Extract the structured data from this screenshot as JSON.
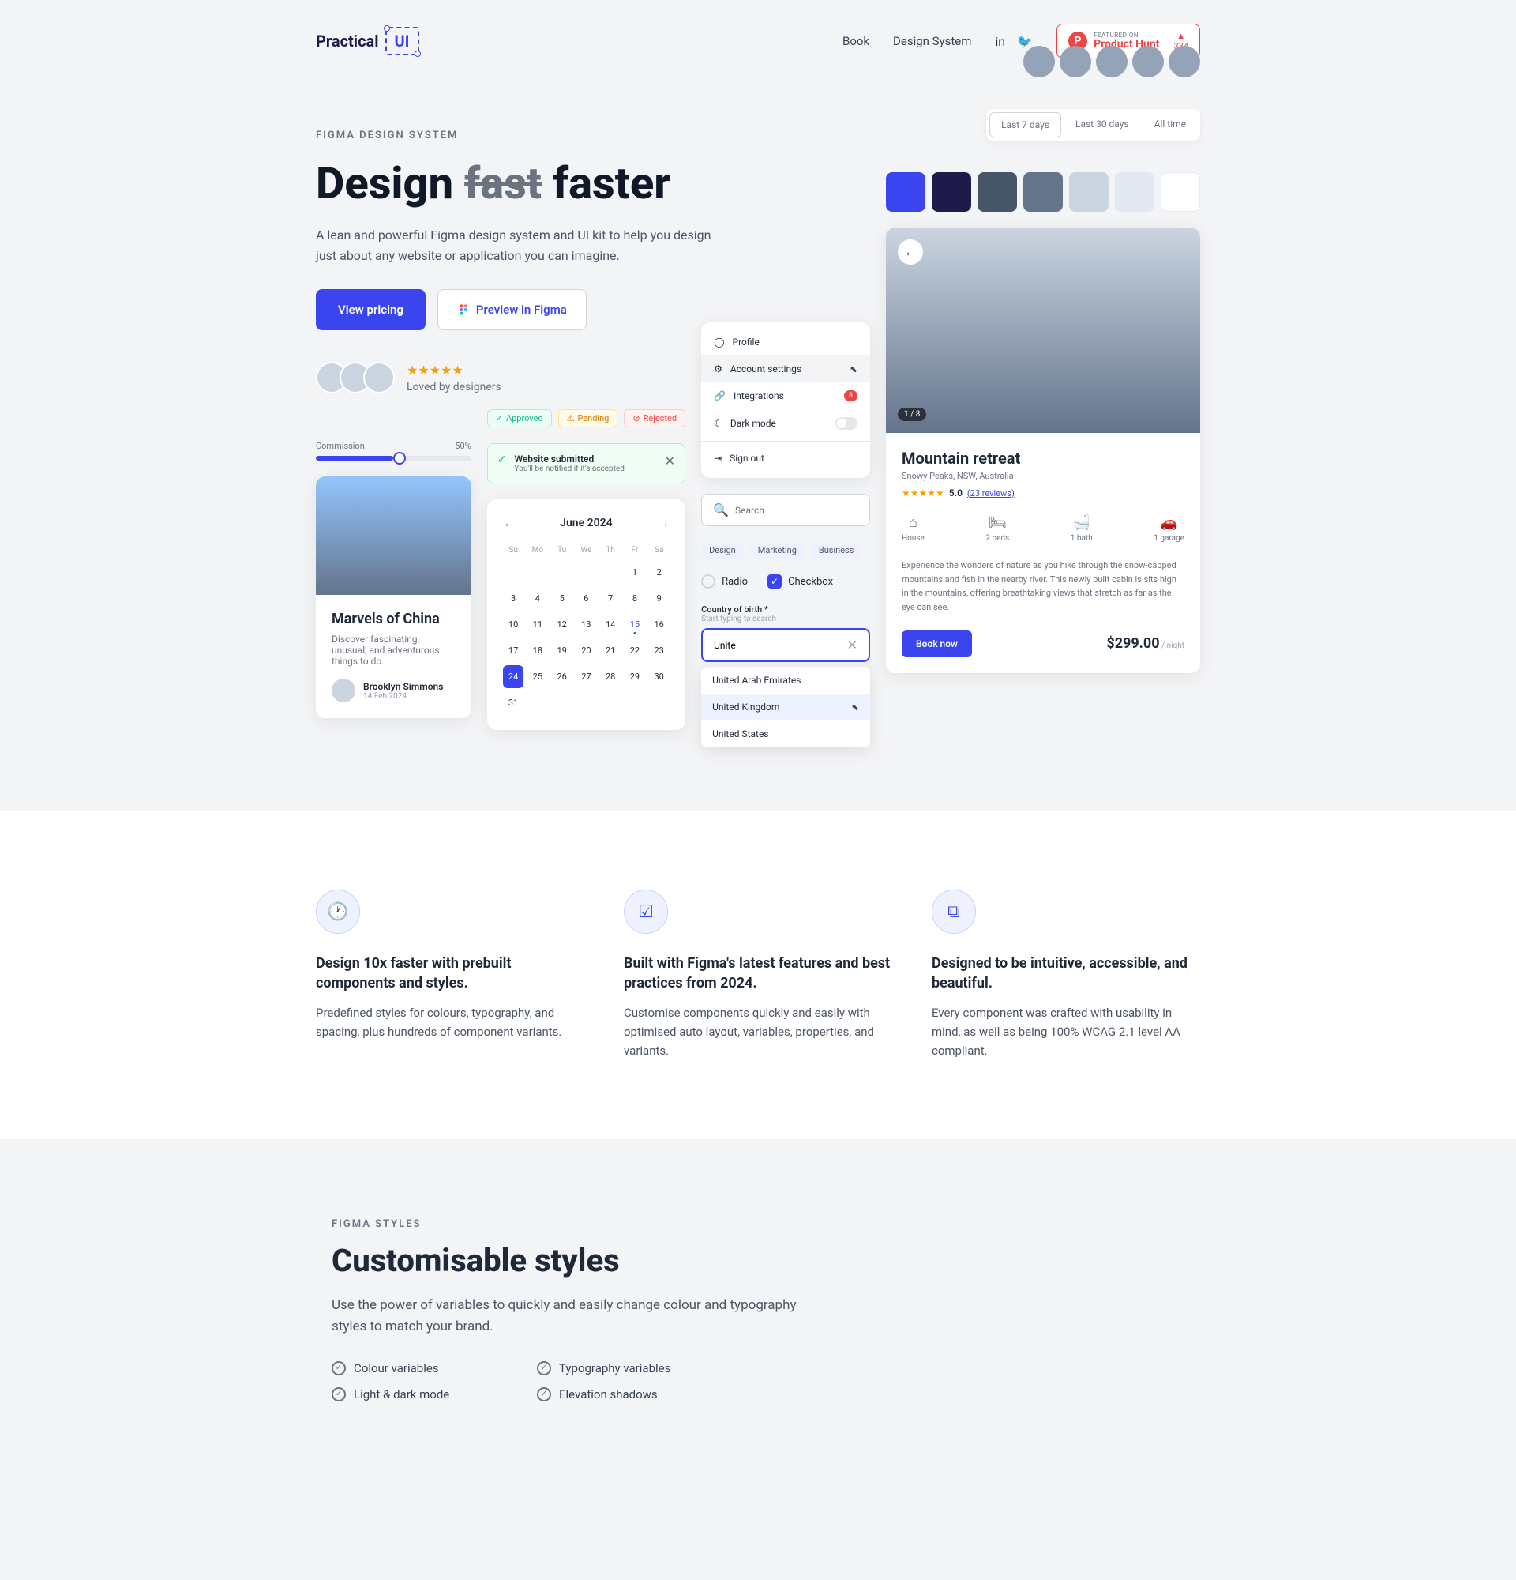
{
  "header": {
    "logo_text": "Practical",
    "logo_box": "UI",
    "nav": {
      "book": "Book",
      "design_system": "Design System"
    },
    "ph": {
      "featured": "FEATURED ON",
      "name": "Product Hunt",
      "count": "334"
    }
  },
  "hero": {
    "eyebrow": "FIGMA DESIGN SYSTEM",
    "title_a": "Design ",
    "title_strike": "fast",
    "title_b": " faster",
    "subtitle": "A lean and powerful Figma design system and UI kit to help you design just about any website or application you can imagine.",
    "btn_primary": "View pricing",
    "btn_secondary": "Preview in Figma",
    "loved": "Loved by designers"
  },
  "tabs": {
    "t1": "Last 7 days",
    "t2": "Last 30 days",
    "t3": "All time"
  },
  "swatches": [
    "#3b45ef",
    "#1e1b4b",
    "#475569",
    "#64748b",
    "#cbd5e1",
    "#e2e8f0",
    "#ffffff"
  ],
  "badges": {
    "approved": "Approved",
    "pending": "Pending",
    "rejected": "Rejected"
  },
  "slider": {
    "label": "Commission",
    "value": "50%"
  },
  "article": {
    "title": "Marvels of China",
    "desc": "Discover fascinating, unusual, and adventurous things to do.",
    "author": "Brooklyn Simmons",
    "date": "14 Feb 2024"
  },
  "toast": {
    "title": "Website submitted",
    "sub": "You'll be notified if it's accepted"
  },
  "calendar": {
    "month": "June 2024",
    "dow": [
      "Su",
      "Mo",
      "Tu",
      "We",
      "Th",
      "Fr",
      "Sa"
    ],
    "days": [
      "",
      "",
      "",
      "",
      "",
      "1",
      "2",
      "3",
      "4",
      "5",
      "6",
      "7",
      "8",
      "9",
      "10",
      "11",
      "12",
      "13",
      "14",
      "15",
      "16",
      "17",
      "18",
      "19",
      "20",
      "21",
      "22",
      "23",
      "24",
      "25",
      "26",
      "27",
      "28",
      "29",
      "30",
      "31"
    ],
    "today": "15",
    "selected": "24"
  },
  "menu": {
    "profile": "Profile",
    "settings": "Account settings",
    "integrations": "Integrations",
    "badge": "8",
    "darkmode": "Dark mode",
    "signout": "Sign out"
  },
  "search_placeholder": "Search",
  "tags": {
    "t1": "Design",
    "t2": "Marketing",
    "t3": "Business"
  },
  "radio_label": "Radio",
  "checkbox_label": "Checkbox",
  "combo": {
    "label": "Country of birth *",
    "hint": "Start typing to search",
    "value": "Unite",
    "opt1": "United Arab Emirates",
    "opt2": "United Kingdom",
    "opt3": "United States"
  },
  "property": {
    "count": "1 / 8",
    "title": "Mountain retreat",
    "location": "Snowy Peaks, NSW, Australia",
    "rating": "5.0",
    "reviews": "(23 reviews)",
    "f1": "House",
    "f2": "2 beds",
    "f3": "1 bath",
    "f4": "1 garage",
    "desc": "Experience the wonders of nature as you hike through the snow-capped mountains and fish in the nearby river. This newly built cabin is sits high in the mountains, offering breathtaking views that stretch as far as the eye can see.",
    "book": "Book now",
    "price": "$299.00",
    "unit": " / night"
  },
  "features": {
    "f1_title": "Design 10x faster with prebuilt components and styles.",
    "f1_desc": "Predefined styles for colours, typography, and spacing, plus hundreds of component variants.",
    "f2_title": "Built with Figma's latest features and best practices from 2024.",
    "f2_desc": "Customise components quickly and easily with optimised auto layout, variables, properties, and variants.",
    "f3_title": "Designed to be intuitive, accessible, and beautiful.",
    "f3_desc": "Every component was crafted with usability in mind, as well as being 100% WCAG 2.1 level AA compliant."
  },
  "styles": {
    "eyebrow": "FIGMA STYLES",
    "title": "Customisable styles",
    "sub": "Use the power of variables to quickly and easily change colour and typography styles to match your brand.",
    "c1": "Colour variables",
    "c2": "Typography variables",
    "c3": "Light & dark mode",
    "c4": "Elevation shadows"
  }
}
